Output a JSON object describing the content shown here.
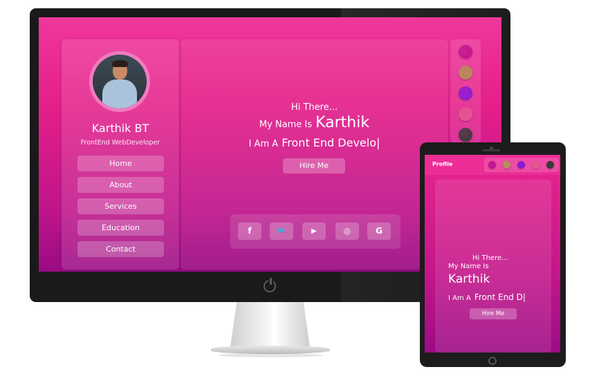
{
  "desktop": {
    "profile": {
      "name": "Karthik BT",
      "role": "FrontEnd WebDeveloper"
    },
    "nav": [
      "Home",
      "About",
      "Services",
      "Education",
      "Contact"
    ],
    "hero": {
      "line1": "Hi There...",
      "line2_prefix": "My Name Is",
      "line2_name": "Karthik",
      "line3_prefix": "I Am A",
      "line3_typed": "Front End Develo|",
      "hire_label": "Hire Me"
    },
    "social_icons": [
      {
        "name": "facebook-icon",
        "glyph": "f"
      },
      {
        "name": "twitter-icon",
        "glyph": "🐦"
      },
      {
        "name": "youtube-icon",
        "glyph": "▶"
      },
      {
        "name": "instagram-icon",
        "glyph": "◎"
      },
      {
        "name": "google-icon",
        "glyph": "G"
      }
    ],
    "theme_colors": [
      "#c2178f",
      "#b58f55",
      "#8a1ad6",
      "#e3578f",
      "#3a3a3a"
    ]
  },
  "tablet": {
    "brand": "Profile",
    "theme_colors": [
      "#c2178f",
      "#b58f55",
      "#8a1ad6",
      "#e3578f",
      "#3a3a3a"
    ],
    "hero": {
      "line1": "Hi There...",
      "line2": "My Name Is",
      "name": "Karthik",
      "line3_prefix": "I Am A",
      "line3_typed": "Front End D|",
      "hire_label": "Hire Me"
    }
  }
}
